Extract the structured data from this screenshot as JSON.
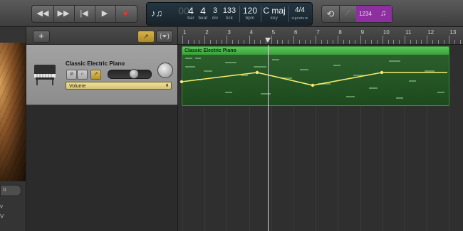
{
  "transport": {
    "buttons": [
      {
        "name": "rewind-button",
        "glyph": "◀◀"
      },
      {
        "name": "fast-forward-button",
        "glyph": "▶▶"
      },
      {
        "name": "go-to-beginning-button",
        "glyph": "|◀"
      },
      {
        "name": "play-button",
        "glyph": "▶"
      },
      {
        "name": "record-button",
        "glyph": "●"
      }
    ]
  },
  "lcd": {
    "icon_glyph": "♪♫",
    "bar_prefix": "00",
    "bar": "4",
    "beat": "4",
    "div": "3",
    "tick": "133",
    "bpm": "120",
    "key": "C maj",
    "signature": "4/4",
    "labels": {
      "bar": "bar",
      "beat": "beat",
      "div": "div",
      "tick": "tick",
      "bpm": "bpm",
      "key": "key",
      "signature": "signature"
    }
  },
  "right_tools": {
    "cycle_glyph": "⟲",
    "tuner_glyph": "⟋",
    "count_in": "1234",
    "metronome_glyph": "♫"
  },
  "left_strip": {
    "line1": "o",
    "line2": "v",
    "line3": "V"
  },
  "track_panel": {
    "add_label": "+",
    "auto_glyph": "↗",
    "filter_glyph": "⟨⏷⟩"
  },
  "track": {
    "name": "Classic Electric Piano",
    "automation_parameter": "Volume",
    "mute_glyph": "⊘",
    "headphone_glyph": "∩",
    "auto_glyph": "↗",
    "volume_level": 0.58
  },
  "ruler": {
    "bars": [
      "1",
      "2",
      "3",
      "4",
      "5",
      "6",
      "7",
      "8",
      "9",
      "10",
      "11",
      "12",
      "13"
    ]
  },
  "region": {
    "name": "Classic Electric Piano"
  },
  "colors": {
    "region": "#39a139",
    "automation": "#f4eb6f",
    "accent": "#b23cc3"
  }
}
